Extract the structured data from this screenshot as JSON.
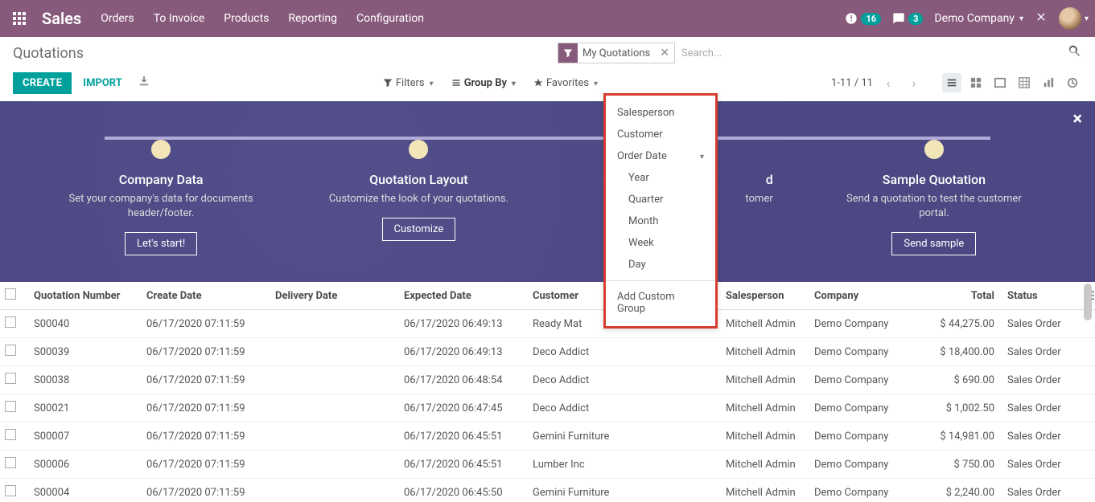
{
  "app": {
    "brand": "Sales"
  },
  "nav": {
    "items": [
      "Orders",
      "To Invoice",
      "Products",
      "Reporting",
      "Configuration"
    ]
  },
  "systray": {
    "clock_badge": "16",
    "messages_badge": "3",
    "company": "Demo Company"
  },
  "breadcrumb": "Quotations",
  "search": {
    "facet_label": "My Quotations",
    "placeholder": "Search..."
  },
  "actions": {
    "create": "CREATE",
    "import": "IMPORT"
  },
  "searchbar": {
    "filters": "Filters",
    "groupby": "Group By",
    "favorites": "Favorites"
  },
  "groupby_menu": {
    "salesperson": "Salesperson",
    "customer": "Customer",
    "order_date": "Order Date",
    "year": "Year",
    "quarter": "Quarter",
    "month": "Month",
    "week": "Week",
    "day": "Day",
    "add_custom": "Add Custom Group"
  },
  "pager": {
    "range": "1-11",
    "total": "11"
  },
  "onboard": {
    "cards": [
      {
        "title": "Company Data",
        "desc": "Set your company's data for documents header/footer.",
        "btn": "Let's start!"
      },
      {
        "title": "Quotation Layout",
        "desc": "Customize the look of your quotations.",
        "btn": "Customize"
      },
      {
        "title": "d",
        "desc": "tomer",
        "btn": ""
      },
      {
        "title": "Sample Quotation",
        "desc": "Send a quotation to test the customer portal.",
        "btn": "Send sample"
      }
    ]
  },
  "columns": {
    "qn": "Quotation Number",
    "cd": "Create Date",
    "dd": "Delivery Date",
    "ed": "Expected Date",
    "cu": "Customer",
    "sp": "Salesperson",
    "co": "Company",
    "to": "Total",
    "st": "Status"
  },
  "rows": [
    {
      "qn": "S00040",
      "cd": "06/17/2020 07:11:59",
      "dd": "",
      "ed": "06/17/2020 06:49:13",
      "cu": "Ready Mat",
      "sp": "Mitchell Admin",
      "co": "Demo Company",
      "to": "$ 44,275.00",
      "st": "Sales Order"
    },
    {
      "qn": "S00039",
      "cd": "06/17/2020 07:11:59",
      "dd": "",
      "ed": "06/17/2020 06:49:13",
      "cu": "Deco Addict",
      "sp": "Mitchell Admin",
      "co": "Demo Company",
      "to": "$ 18,400.00",
      "st": "Sales Order"
    },
    {
      "qn": "S00038",
      "cd": "06/17/2020 07:11:59",
      "dd": "",
      "ed": "06/17/2020 06:48:54",
      "cu": "Deco Addict",
      "sp": "Mitchell Admin",
      "co": "Demo Company",
      "to": "$ 690.00",
      "st": "Sales Order"
    },
    {
      "qn": "S00021",
      "cd": "06/17/2020 07:11:59",
      "dd": "",
      "ed": "06/17/2020 06:47:45",
      "cu": "Deco Addict",
      "sp": "Mitchell Admin",
      "co": "Demo Company",
      "to": "$ 1,002.50",
      "st": "Sales Order"
    },
    {
      "qn": "S00007",
      "cd": "06/17/2020 07:11:59",
      "dd": "",
      "ed": "06/17/2020 06:45:51",
      "cu": "Gemini Furniture",
      "sp": "Mitchell Admin",
      "co": "Demo Company",
      "to": "$ 14,981.00",
      "st": "Sales Order"
    },
    {
      "qn": "S00006",
      "cd": "06/17/2020 07:11:59",
      "dd": "",
      "ed": "06/17/2020 06:45:51",
      "cu": "Lumber Inc",
      "sp": "Mitchell Admin",
      "co": "Demo Company",
      "to": "$ 750.00",
      "st": "Sales Order"
    },
    {
      "qn": "S00004",
      "cd": "06/17/2020 07:11:59",
      "dd": "",
      "ed": "06/17/2020 06:45:50",
      "cu": "Gemini Furniture",
      "sp": "Mitchell Admin",
      "co": "Demo Company",
      "to": "$ 2,240.00",
      "st": "Sales Order"
    }
  ]
}
